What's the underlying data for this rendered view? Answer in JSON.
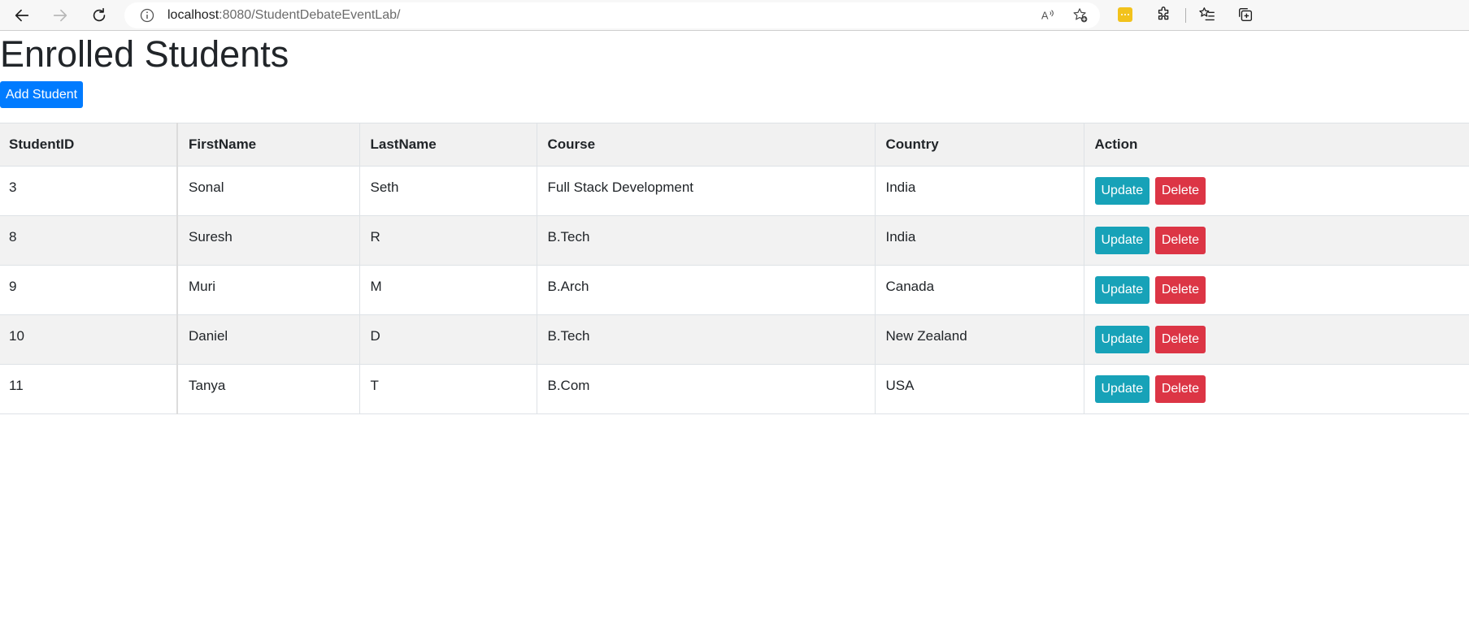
{
  "browser": {
    "url_host": "localhost",
    "url_rest": ":8080/StudentDebateEventLab/",
    "icons": {
      "back": "back-arrow-icon",
      "forward": "forward-arrow-icon",
      "refresh": "refresh-icon",
      "info": "info-icon",
      "read_aloud": "read-aloud-icon",
      "add_favorite": "add-favorite-icon",
      "extension": "yellow-extension-icon",
      "extensions": "puzzle-icon",
      "favorites": "favorites-icon",
      "collections": "collections-icon"
    }
  },
  "page": {
    "title": "Enrolled Students",
    "add_button": "Add Student"
  },
  "table": {
    "headers": [
      "StudentID",
      "FirstName",
      "LastName",
      "Course",
      "Country",
      "Action"
    ],
    "rows": [
      {
        "id": "3",
        "first": "Sonal",
        "last": "Seth",
        "course": "Full Stack Development",
        "country": "India"
      },
      {
        "id": "8",
        "first": "Suresh",
        "last": "R",
        "course": "B.Tech",
        "country": "India"
      },
      {
        "id": "9",
        "first": "Muri",
        "last": "M",
        "course": "B.Arch",
        "country": "Canada"
      },
      {
        "id": "10",
        "first": "Daniel",
        "last": "D",
        "course": "B.Tech",
        "country": "New Zealand"
      },
      {
        "id": "11",
        "first": "Tanya",
        "last": "T",
        "course": "B.Com",
        "country": "USA"
      }
    ],
    "update_label": "Update",
    "delete_label": "Delete"
  },
  "colors": {
    "primary": "#007bff",
    "info": "#17a2b8",
    "danger": "#dc3545"
  }
}
